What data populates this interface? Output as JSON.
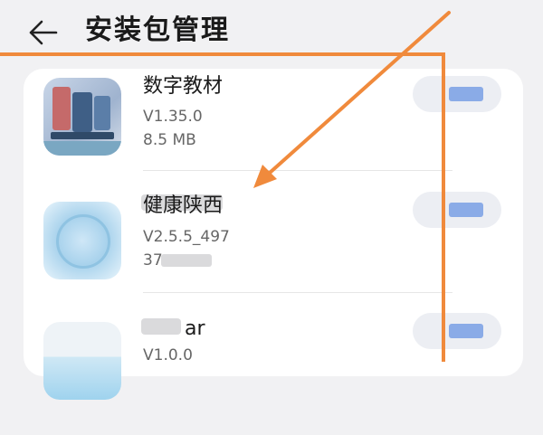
{
  "header": {
    "title": "安装包管理"
  },
  "apps": [
    {
      "name": "数字教材",
      "version": "V1.35.0",
      "size": "8.5 MB"
    },
    {
      "name": "健康陕西",
      "version": "V2.5.5_497",
      "size": "37"
    },
    {
      "name": "ar",
      "version": "V1.0.0",
      "size": ""
    }
  ],
  "annotation": {
    "color": "#f08a3c"
  }
}
